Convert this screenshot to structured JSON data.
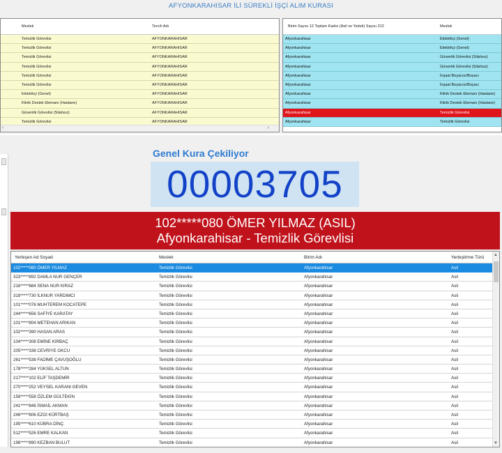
{
  "title": "AFYONKARAHISAR İLİ SÜREKLİ İŞÇİ ALIM KURASI",
  "top_left": {
    "headers": [
      "Meslek",
      "Tercih Adı"
    ],
    "rows": [
      [
        "Temizlik Görevlisi",
        "AFYONKARAHISAR"
      ],
      [
        "Temizlik Görevlisi",
        "AFYONKARAHISAR"
      ],
      [
        "Temizlik Görevlisi",
        "AFYONKARAHISAR"
      ],
      [
        "Temizlik Görevlisi",
        "AFYONKARAHISAR"
      ],
      [
        "Temizlik Görevlisi",
        "AFYONKARAHISAR"
      ],
      [
        "Temizlik Görevlisi",
        "AFYONKARAHISAR"
      ],
      [
        "Elektrikçi (Genel)",
        "AFYONKARAHISAR"
      ],
      [
        "Klinik Destek Elemanı (Hastane)",
        "AFYONKARAHISAR"
      ],
      [
        "Güvenlik Görevlisi (Silahsız)",
        "AFYONKARAHISAR"
      ],
      [
        "Temizlik Görevlisi",
        "AFYONKARAHISAR"
      ]
    ]
  },
  "top_right": {
    "headers": [
      "Birim Sayısı 12 Toplam Kadro (Asil ve Yedek) Sayısı 212",
      "Meslek"
    ],
    "rows": [
      [
        "Afyonkarahisar",
        "Elektrikçi (Genel)"
      ],
      [
        "Afyonkarahisar",
        "Elektrikçi (Genel)"
      ],
      [
        "Afyonkarahisar",
        "Güvenlik Görevlisi (Silahsız)"
      ],
      [
        "Afyonkarahisar",
        "Güvenlik Görevlisi (Silahsız)"
      ],
      [
        "Afyonkarahisar",
        "İnşaat Boyacısı/Boyacı"
      ],
      [
        "Afyonkarahisar",
        "İnşaat Boyacısı/Boyacı"
      ],
      [
        "Afyonkarahisar",
        "Klinik Destek Elemanı (Hastane)"
      ],
      [
        "Afyonkarahisar",
        "Klinik Destek Elemanı (Hastane)"
      ],
      [
        "Afyonkarahisar",
        "Temizlik Görevlisi"
      ],
      [
        "Afyonkarahisar",
        "Temizlik Görevlisi"
      ]
    ],
    "selected_index": 8
  },
  "draw": {
    "subtitle": "Genel Kura Çekiliyor",
    "number": "00003705",
    "winner_line1": "102*****080 ÖMER YILMAZ (ASIL)",
    "winner_line2": "Afyonkarahisar - Temizlik Görevlisi"
  },
  "bottom": {
    "headers": [
      "Yerleşen Ad Soyad",
      "Meslek",
      "Birim Adı",
      "Yerleştirme Türü"
    ],
    "rows": [
      [
        "102*****080 ÖMER YILMAZ",
        "Temizlik Görevlisi",
        "Afyonkarahisar",
        "Asil"
      ],
      [
        "323*****892 DAMLA NUR GENÇER",
        "Temizlik Görevlisi",
        "Afyonkarahisar",
        "Asil"
      ],
      [
        "216*****684 SENA NUR KIRAZ",
        "Temizlik Görevlisi",
        "Afyonkarahisar",
        "Asil"
      ],
      [
        "318*****730 İLKNUR YARDIMCI",
        "Temizlik Görevlisi",
        "Afyonkarahisar",
        "Asil"
      ],
      [
        "101*****076 MUHTEREM KOCATEPE",
        "Temizlik Görevlisi",
        "Afyonkarahisar",
        "Asil"
      ],
      [
        "244*****656 SAFİYE KARATAY",
        "Temizlik Görevlisi",
        "Afyonkarahisar",
        "Asil"
      ],
      [
        "101*****804 METEHAN ARIKAN",
        "Temizlik Görevlisi",
        "Afyonkarahisar",
        "Asil"
      ],
      [
        "102*****390 HASAN ARAS",
        "Temizlik Görevlisi",
        "Afyonkarahisar",
        "Asil"
      ],
      [
        "104*****308 EMİNE KIRBAÇ",
        "Temizlik Görevlisi",
        "Afyonkarahisar",
        "Asil"
      ],
      [
        "205*****338 CEVRİYE OKCU",
        "Temizlik Görevlisi",
        "Afyonkarahisar",
        "Asil"
      ],
      [
        "261*****538 FADİME ÇAVUŞOĞLU",
        "Temizlik Görevlisi",
        "Afyonkarahisar",
        "Asil"
      ],
      [
        "178*****284 YÜKSEL ALTUN",
        "Temizlik Görevlisi",
        "Afyonkarahisar",
        "Asil"
      ],
      [
        "217*****102 ELİF TAŞDEMİR",
        "Temizlik Görevlisi",
        "Afyonkarahisar",
        "Asil"
      ],
      [
        "270*****252 VEYSEL KARANI GEVEN",
        "Temizlik Görevlisi",
        "Afyonkarahisar",
        "Asil"
      ],
      [
        "159*****558 ÖZLEM GÜLTEKİN",
        "Temizlik Görevlisi",
        "Afyonkarahisar",
        "Asil"
      ],
      [
        "241*****846 İSMAİL AKMAN",
        "Temizlik Görevlisi",
        "Afyonkarahisar",
        "Asil"
      ],
      [
        "246*****806 EZGİ KÜRTBAŞ",
        "Temizlik Görevlisi",
        "Afyonkarahisar",
        "Asil"
      ],
      [
        "195*****610 KÜBRA DİNÇ",
        "Temizlik Görevlisi",
        "Afyonkarahisar",
        "Asil"
      ],
      [
        "512*****526 EMRE KALKAN",
        "Temizlik Görevlisi",
        "Afyonkarahisar",
        "Asil"
      ],
      [
        "196*****890 KEZBAN BULUT",
        "Temizlik Görevlisi",
        "Afyonkarahisar",
        "Asil"
      ]
    ],
    "selected_index": 0
  }
}
